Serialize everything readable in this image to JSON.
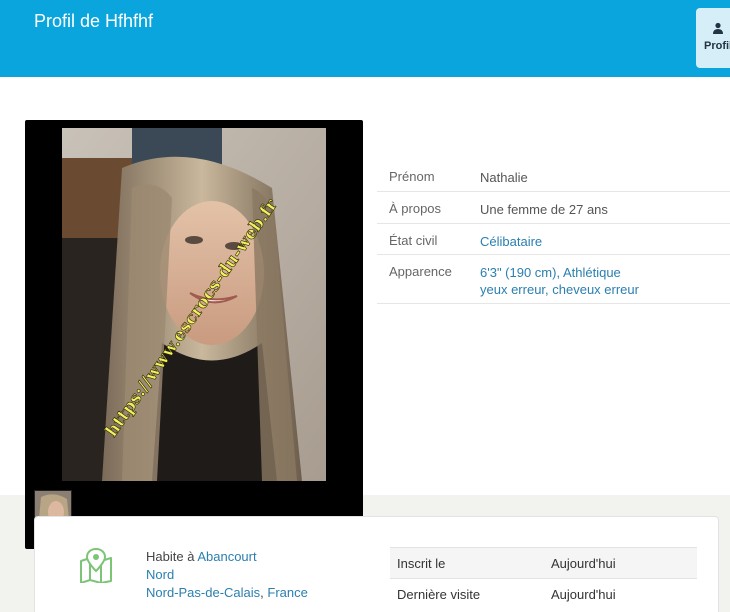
{
  "header": {
    "title": "Profil de Hfhfhf",
    "tab_label": "Profil"
  },
  "photo": {
    "watermark": "https://www.escrocs-du-web.fr"
  },
  "profile_info": [
    {
      "label": "Prénom",
      "value": "Nathalie"
    },
    {
      "label": "À propos",
      "value": "Une femme de 27 ans"
    },
    {
      "label": "État civil",
      "value": "Célibataire"
    },
    {
      "label": "Apparence",
      "value_line1": "6'3\" (190 cm), Athlétique",
      "value_line2": "yeux erreur, cheveux erreur"
    }
  ],
  "location": {
    "prefix": "Habite à ",
    "city": "Abancourt",
    "department": "Nord",
    "region": "Nord-Pas-de-Calais",
    "separator": ", ",
    "country": "France"
  },
  "stats": [
    {
      "label": "Inscrit le",
      "value": "Aujourd'hui"
    },
    {
      "label": "Dernière visite",
      "value": "Aujourd'hui"
    }
  ],
  "colors": {
    "header_bg": "#0aa5dc",
    "link": "#2a7fb0",
    "map_icon": "#7cc576"
  },
  "icons": {
    "tab": "user-icon",
    "location": "map-marker-icon"
  }
}
